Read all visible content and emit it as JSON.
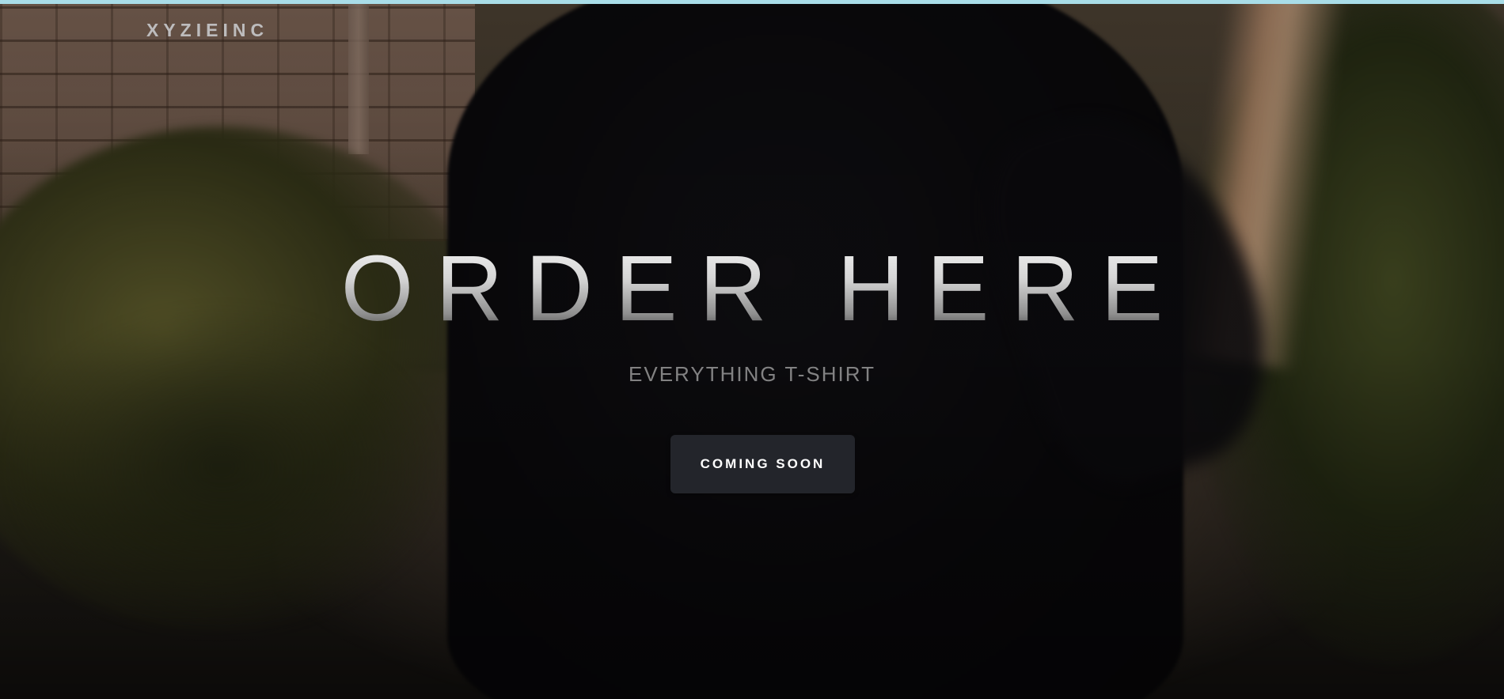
{
  "header": {
    "brand": "XYZIEINC"
  },
  "hero": {
    "title": "ORDER HERE",
    "subtitle": "EVERYTHING T-SHIRT",
    "cta_label": "COMING SOON"
  },
  "colors": {
    "top_strip": "#a9dde8",
    "button_bg": "#23252b",
    "button_text": "#ffffff",
    "brand_text": "#bdbcbd"
  }
}
